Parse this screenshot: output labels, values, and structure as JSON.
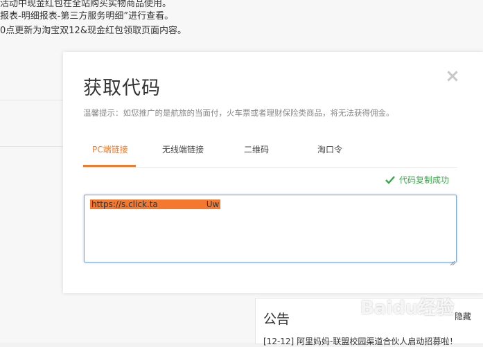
{
  "background": {
    "line1": "活动中现金红包在全站购买实物商品使用。",
    "line2": "报表-明细报表-第三方服务明细”进行查看。",
    "line3": "0点更新为淘宝双12&现金红包领取页面内容。"
  },
  "modal": {
    "title": "获取代码",
    "close_label": "×",
    "tip": "温馨提示：如您推广的是航旅的当面付，火车票或者理财保险类商品，将无法获得佣金。",
    "tabs": [
      {
        "label": "PC端链接",
        "active": true
      },
      {
        "label": "无线端链接",
        "active": false
      },
      {
        "label": "二维码",
        "active": false
      },
      {
        "label": "淘口令",
        "active": false
      }
    ],
    "copy_status": "代码复制成功",
    "code_prefix": "https://s.click.ta",
    "code_suffix": "Uw"
  },
  "notice": {
    "title": "公告",
    "hide_label": "隐藏",
    "item": "[12-12]   阿里妈妈-联盟校园渠道合伙人启动招募啦！"
  },
  "watermark": "Baidu经验",
  "colors": {
    "accent": "#f07b30",
    "success": "#3aa64a",
    "input_border": "#7aa7d6"
  }
}
